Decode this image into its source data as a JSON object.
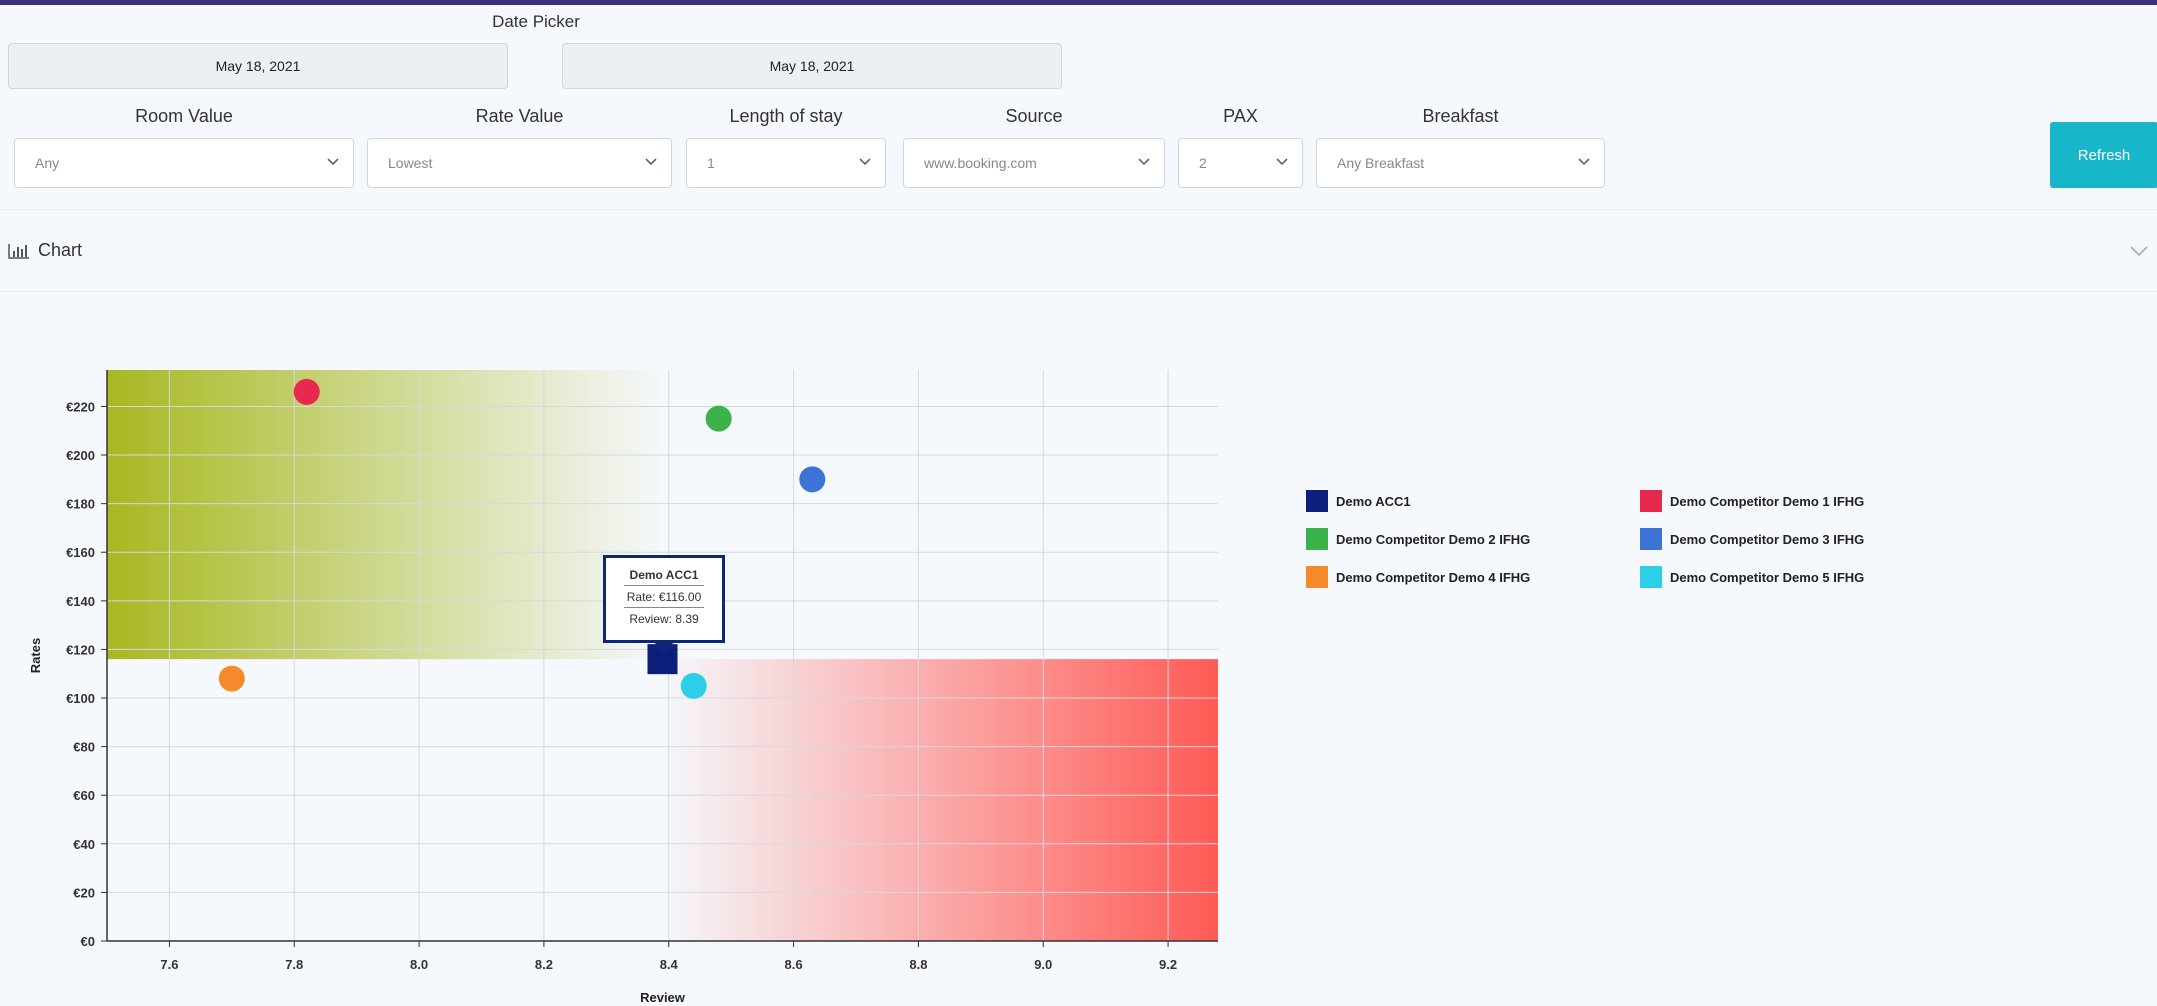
{
  "date_picker": {
    "label": "Date Picker",
    "start": "May 18, 2021",
    "end": "May 18, 2021"
  },
  "filters": [
    {
      "label": "Room Value",
      "value": "Any"
    },
    {
      "label": "Rate Value",
      "value": "Lowest"
    },
    {
      "label": "Length of stay",
      "value": "1"
    },
    {
      "label": "Source",
      "value": "www.booking.com"
    },
    {
      "label": "PAX",
      "value": "2"
    },
    {
      "label": "Breakfast",
      "value": "Any Breakfast"
    }
  ],
  "refresh_label": "Refresh",
  "section": {
    "title": "Chart",
    "icon": "bar-chart-icon",
    "collapse_icon": "chevron-down-icon"
  },
  "tooltip": {
    "name": "Demo ACC1",
    "rate": "Rate: €116.00",
    "review": "Review: 8.39"
  },
  "colors": {
    "accent": "#17b6c8",
    "topbar": "#3b2f7a"
  },
  "chart_data": {
    "type": "scatter",
    "xlabel": "Review",
    "ylabel": "Rates",
    "xlim": [
      7.5,
      9.28
    ],
    "ylim": [
      0,
      235
    ],
    "x_ticks": [
      "7.6",
      "7.8",
      "8.0",
      "8.2",
      "8.4",
      "8.6",
      "8.8",
      "9.0",
      "9.2"
    ],
    "y_ticks": [
      "€0",
      "€20",
      "€40",
      "€60",
      "€80",
      "€100",
      "€120",
      "€140",
      "€160",
      "€180",
      "€200",
      "€220"
    ],
    "zones": [
      {
        "x_max": 8.39,
        "y_min": 116,
        "color": "#a8b820",
        "meaning": "high rate / low review"
      },
      {
        "x_min": 8.39,
        "y_max": 116,
        "color": "#ff5a55",
        "meaning": "low rate / high review"
      }
    ],
    "series": [
      {
        "name": "Demo ACC1",
        "color": "#0d1f7a",
        "marker": "square",
        "x": 8.39,
        "y": 116
      },
      {
        "name": "Demo Competitor Demo 1 IFHG",
        "color": "#e8294f",
        "marker": "circle",
        "x": 7.82,
        "y": 226
      },
      {
        "name": "Demo Competitor Demo 2 IFHG",
        "color": "#3cb24a",
        "marker": "circle",
        "x": 8.48,
        "y": 215
      },
      {
        "name": "Demo Competitor Demo 3 IFHG",
        "color": "#3b73d6",
        "marker": "circle",
        "x": 8.63,
        "y": 190
      },
      {
        "name": "Demo Competitor Demo 4 IFHG",
        "color": "#f58a2c",
        "marker": "circle",
        "x": 7.7,
        "y": 108
      },
      {
        "name": "Demo Competitor Demo 5 IFHG",
        "color": "#2bd0e8",
        "marker": "circle",
        "x": 8.44,
        "y": 105
      }
    ]
  }
}
